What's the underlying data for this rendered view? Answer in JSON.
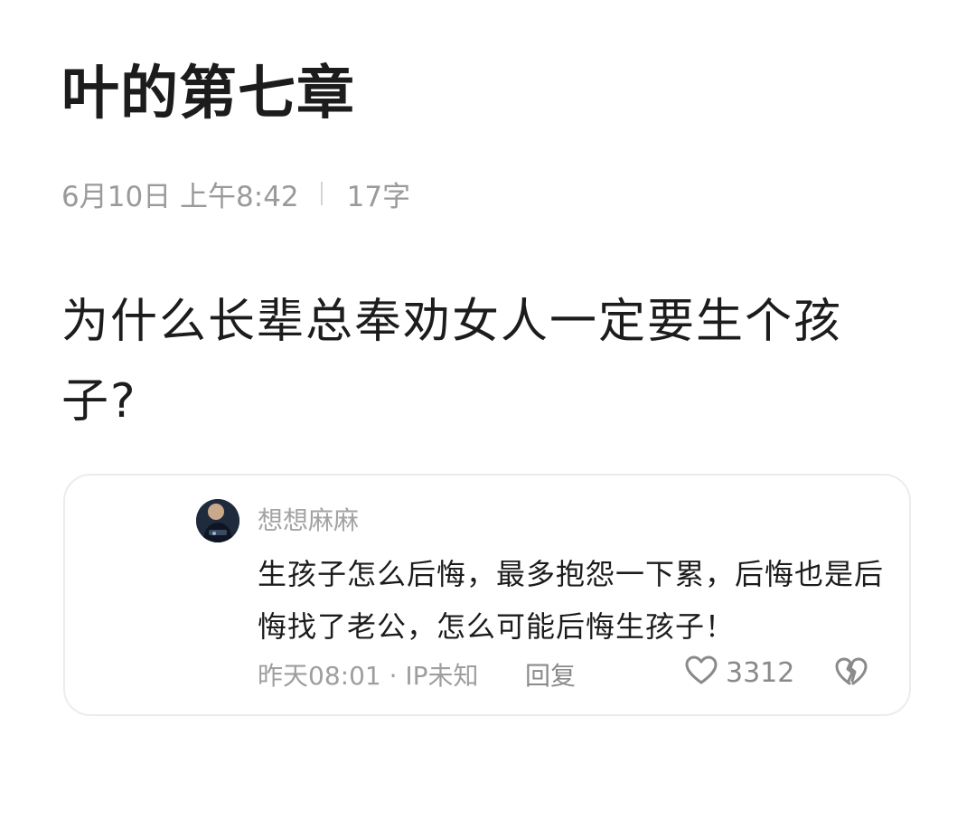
{
  "note": {
    "title": "叶的第七章",
    "date": "6月10日 上午8:42",
    "word_count": "17字",
    "body": "为什么长辈总奉劝女人一定要生个孩子?"
  },
  "comment": {
    "username": "想想麻麻",
    "text": "生孩子怎么后悔，最多抱怨一下累，后悔也是后悔找了老公，怎么可能后悔生孩子！",
    "time": "昨天08:01 · IP未知",
    "reply_label": "回复",
    "like_count": "3312",
    "icons": {
      "avatar": "user-avatar-photo",
      "like": "heart-outline-icon",
      "dislike": "broken-heart-icon"
    }
  },
  "colors": {
    "title_text": "#1c1c1c",
    "meta_text": "#9a9a9a",
    "card_border": "#ececec",
    "secondary_text": "#9e9e9e"
  }
}
